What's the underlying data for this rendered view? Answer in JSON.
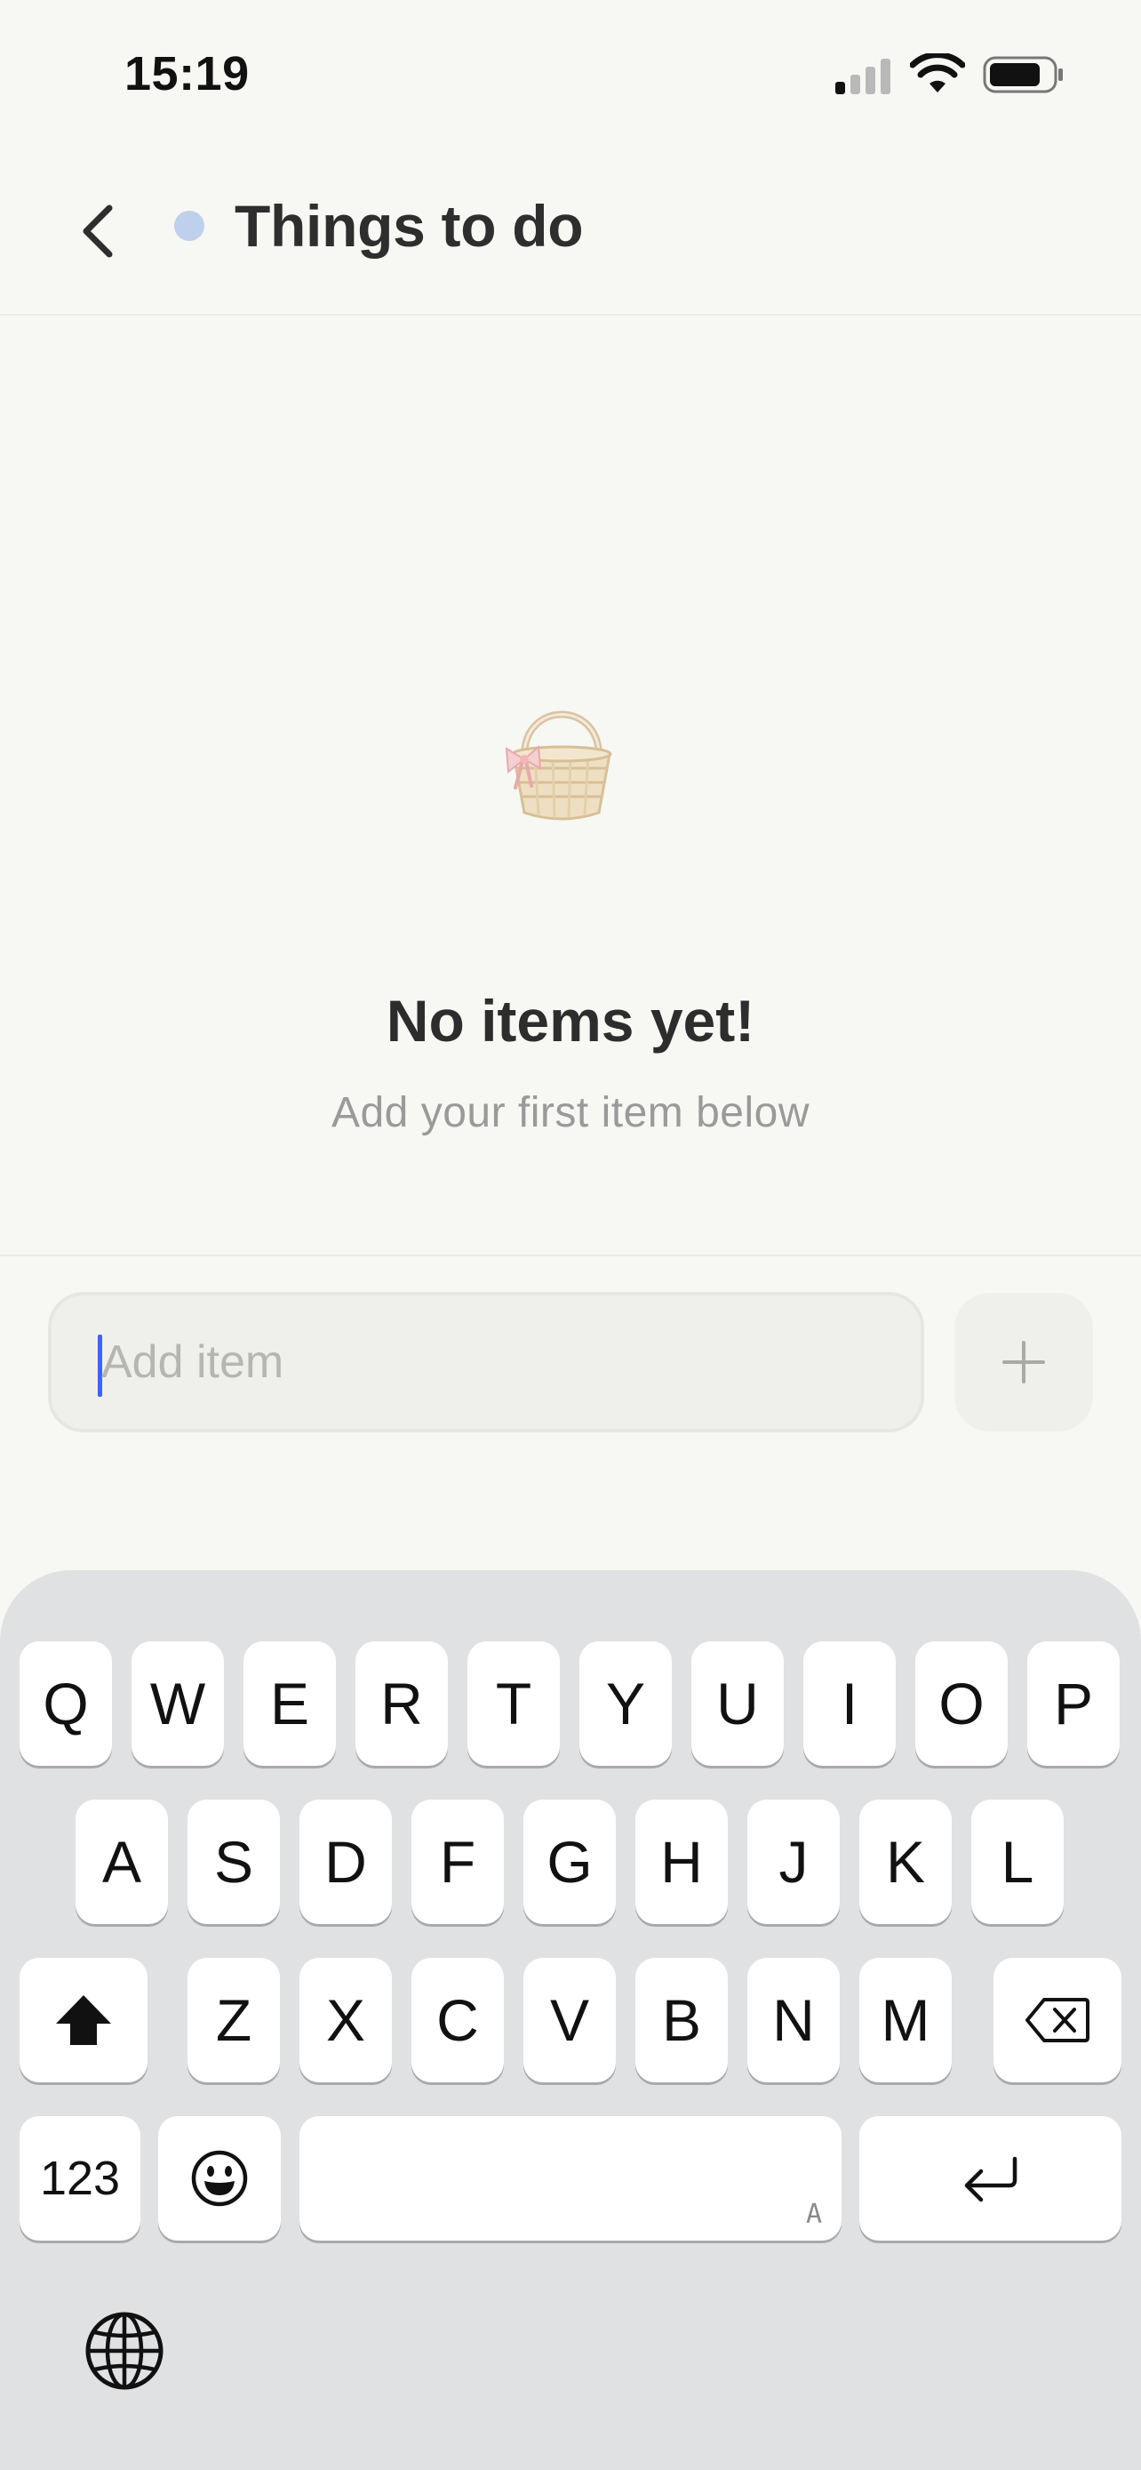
{
  "status_bar": {
    "time": "15:19",
    "signal_icon": "cellular-signal-icon",
    "wifi_icon": "wifi-icon",
    "battery_icon": "battery-icon"
  },
  "header": {
    "back_icon": "chevron-left-icon",
    "title": "Things to do",
    "dot_color": "#bfd0ec"
  },
  "empty_state": {
    "illustration": "basket-icon",
    "title": "No items yet!",
    "subtitle": "Add your first item below"
  },
  "add_bar": {
    "placeholder": "Add item",
    "value": "",
    "button_icon": "plus-icon"
  },
  "keyboard": {
    "row1": [
      "Q",
      "W",
      "E",
      "R",
      "T",
      "Y",
      "U",
      "I",
      "O",
      "P"
    ],
    "row2": [
      "A",
      "S",
      "D",
      "F",
      "G",
      "H",
      "J",
      "K",
      "L"
    ],
    "row3": [
      "Z",
      "X",
      "C",
      "V",
      "B",
      "N",
      "M"
    ],
    "numbers_label": "123",
    "space_hint": "A",
    "shift_icon": "shift-icon",
    "delete_icon": "delete-icon",
    "emoji_icon": "emoji-icon",
    "return_icon": "return-icon",
    "globe_icon": "globe-icon"
  }
}
